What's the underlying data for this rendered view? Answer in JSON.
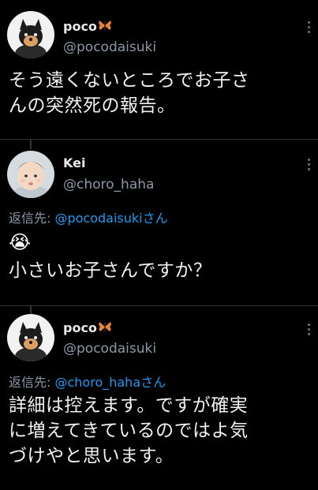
{
  "tweets": [
    {
      "name": "poco",
      "handle": "@pocodaisuki",
      "text_line1": "そう遠くないところでお子さ",
      "text_line2": "んの突然死の報告。"
    },
    {
      "name": "Kei",
      "handle": "@choro_haha",
      "reply_prefix": "返信先: ",
      "reply_mention": "@pocodaisuki",
      "reply_suffix": "さん",
      "emoji": "😭",
      "text_line1": "小さいお子さんですか？"
    },
    {
      "name": "poco",
      "handle": "@pocodaisuki",
      "reply_prefix": "返信先: ",
      "reply_mention": "@choro_haha",
      "reply_suffix": "さん",
      "text_line1": "詳細は控えます。ですが確実",
      "text_line2": "に増えてきているのではよ気",
      "text_line3": "づけやと思います。"
    }
  ],
  "icons": {
    "more": "more-vertical-icon",
    "butterfly": "butterfly-icon"
  },
  "colors": {
    "background": "#000000",
    "mention": "#1d9bf0",
    "secondary_text": "#8b98a5",
    "butterfly": "#e8833a"
  }
}
